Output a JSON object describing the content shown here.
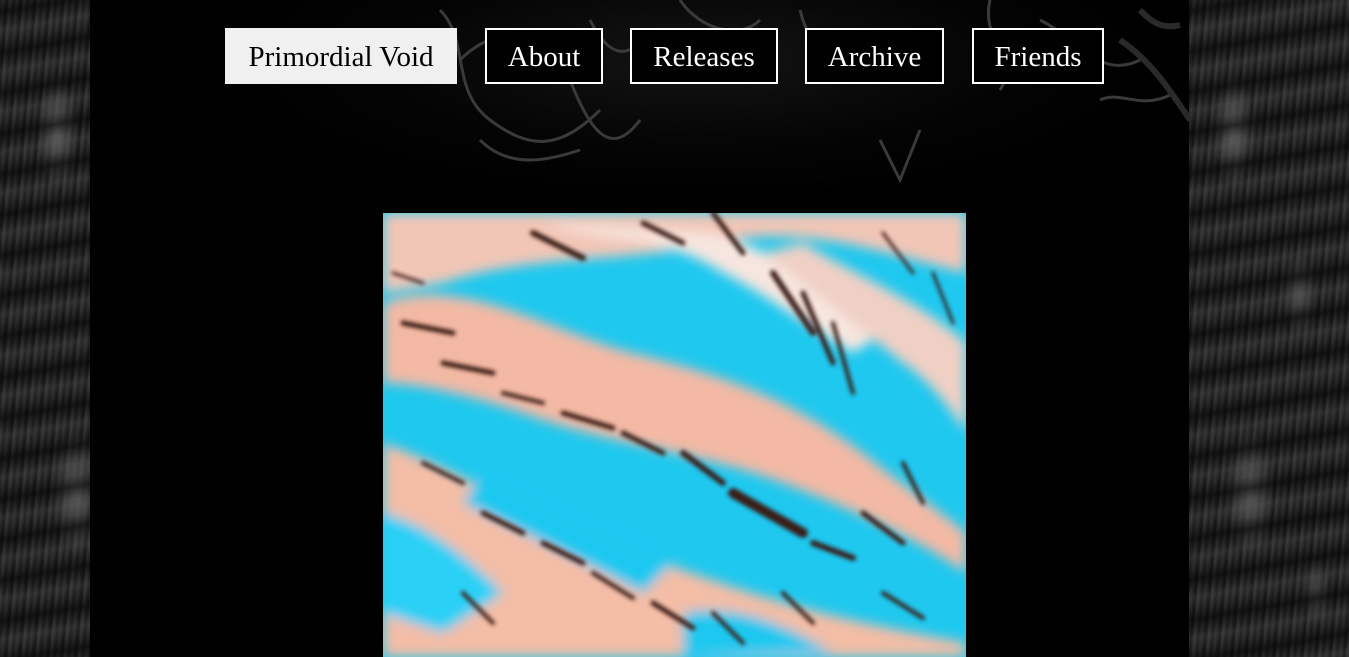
{
  "nav": {
    "home_label": "Primordial Void",
    "about_label": "About",
    "releases_label": "Releases",
    "archive_label": "Archive",
    "friends_label": "Friends"
  },
  "colors": {
    "background": "#000000",
    "nav_border": "#ffffff",
    "nav_active_bg": "#f0f0f0",
    "artwork_cyan": "#1ec8ef",
    "artwork_peach": "#f3b9a4"
  },
  "artwork": {
    "description_icon": "abstract-swirl-artwork"
  }
}
